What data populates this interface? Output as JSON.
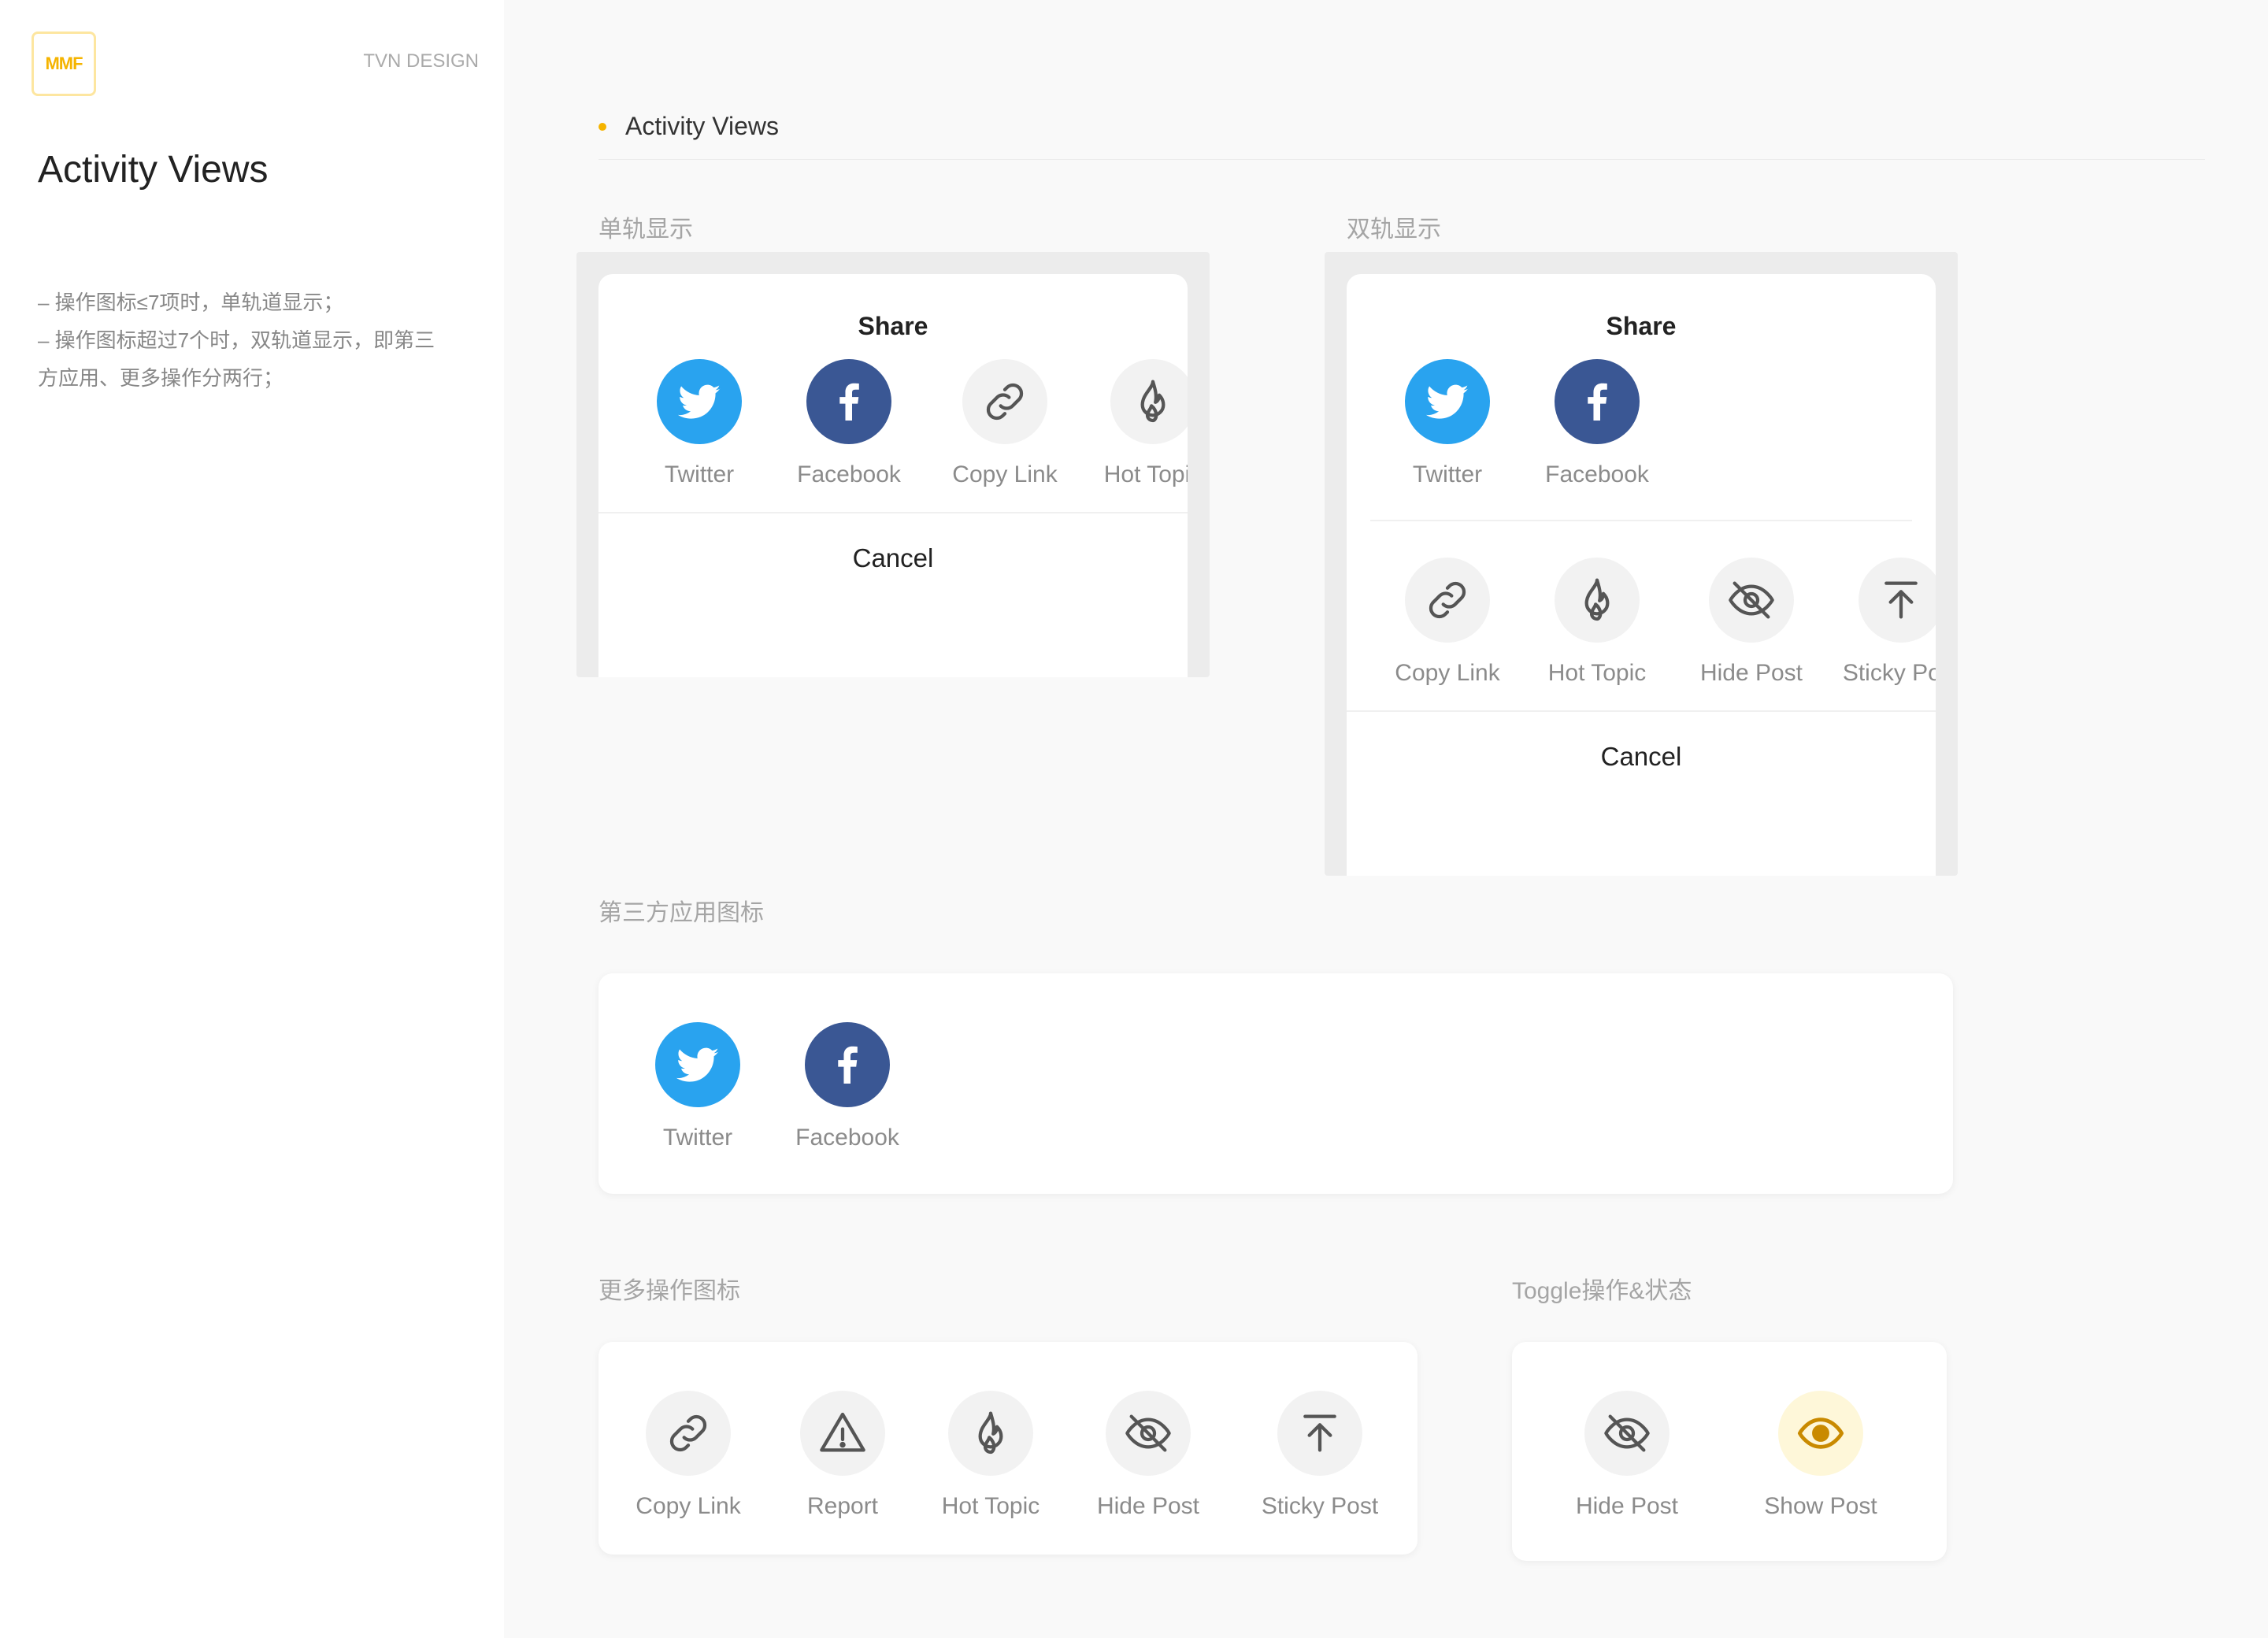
{
  "sidebar": {
    "logo_text": "MMF",
    "brand": "TVN DESIGN",
    "title": "Activity Views",
    "notes": [
      "– 操作图标≤7项时，单轨道显示；",
      "– 操作图标超过7个时，双轨道显示，即第三",
      "方应用、更多操作分两行；"
    ]
  },
  "main": {
    "section_title": "Activity Views"
  },
  "labels": {
    "single_track": "单轨显示",
    "double_track": "双轨显示",
    "third_party": "第三方应用图标",
    "more_actions": "更多操作图标",
    "toggle": "Toggle操作&状态"
  },
  "single_sheet": {
    "title": "Share",
    "cancel": "Cancel",
    "items": [
      "Twitter",
      "Facebook",
      "Copy Link",
      "Hot Topic"
    ]
  },
  "double_sheet": {
    "title": "Share",
    "cancel": "Cancel",
    "row1": [
      "Twitter",
      "Facebook"
    ],
    "row2": [
      "Copy Link",
      "Hot Topic",
      "Hide Post",
      "Sticky Post"
    ]
  },
  "third_party_card": {
    "items": [
      "Twitter",
      "Facebook"
    ]
  },
  "more_actions_card": {
    "items": [
      "Copy Link",
      "Report",
      "Hot Topic",
      "Hide Post",
      "Sticky Post"
    ]
  },
  "toggle_card": {
    "items": [
      "Hide Post",
      "Show Post"
    ]
  },
  "colors": {
    "accent": "#f5b400",
    "twitter": "#29a3ef",
    "facebook": "#3a5794",
    "icon_bg": "#f2f2f2",
    "show_post_bg": "#fef7d9",
    "show_post_icon": "#c98a00"
  },
  "icons": {
    "twitter": "twitter-icon",
    "facebook": "facebook-icon",
    "copy_link": "link-icon",
    "hot_topic": "flame-icon",
    "hide_post": "eye-off-icon",
    "show_post": "eye-icon",
    "sticky_post": "arrow-to-top-icon",
    "report": "warning-icon"
  }
}
